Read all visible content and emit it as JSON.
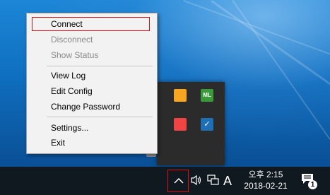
{
  "menu": {
    "items": [
      {
        "label": "Connect",
        "enabled": true
      },
      {
        "label": "Disconnect",
        "enabled": false
      },
      {
        "label": "Show Status",
        "enabled": false
      },
      {
        "label": "View Log",
        "enabled": true
      },
      {
        "label": "Edit Config",
        "enabled": true
      },
      {
        "label": "Change Password",
        "enabled": true
      },
      {
        "label": "Settings...",
        "enabled": true
      },
      {
        "label": "Exit",
        "enabled": true
      }
    ]
  },
  "tray_overflow": {
    "icons": [
      "app-icon-orange",
      "ml-icon",
      "colorful-app-icon",
      "shield-icon"
    ],
    "ml_label": "ML"
  },
  "taskbar": {
    "ime_label": "A",
    "time": "오후 2:15",
    "date": "2018-02-21",
    "notification_count": "1"
  },
  "colors": {
    "highlight_border": "#e01010",
    "menu_background": "#f2f2f2",
    "disabled_text": "#8a8a8a",
    "taskbar": "#101820"
  }
}
